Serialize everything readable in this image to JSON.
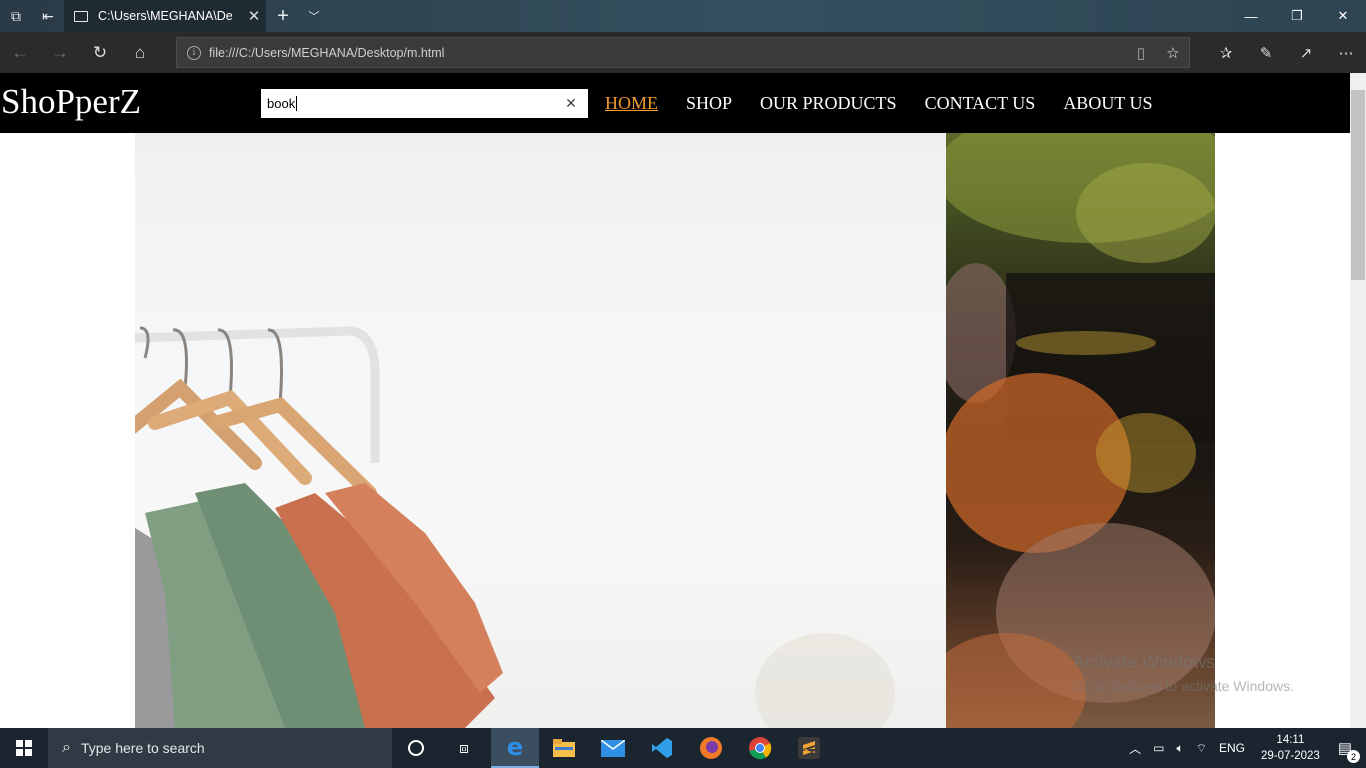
{
  "browser": {
    "tab_title": "C:\\Users\\MEGHANA\\De",
    "url": "file:///C:/Users/MEGHANA/Desktop/m.html"
  },
  "site": {
    "logo": "ShoPperZ",
    "search_value": "book",
    "nav": [
      {
        "label": "HOME",
        "active": true
      },
      {
        "label": "SHOP",
        "active": false
      },
      {
        "label": "OUR PRODUCTS",
        "active": false
      },
      {
        "label": "CONTACT US",
        "active": false
      },
      {
        "label": "ABOUT US",
        "active": false
      }
    ],
    "accent_color": "#f29a2e"
  },
  "watermark": {
    "line1": "Activate Windows",
    "line2": "Go to Settings to activate Windows."
  },
  "taskbar": {
    "search_placeholder": "Type here to search",
    "language": "ENG",
    "time": "14:11",
    "date": "29-07-2023",
    "notification_count": "2"
  }
}
